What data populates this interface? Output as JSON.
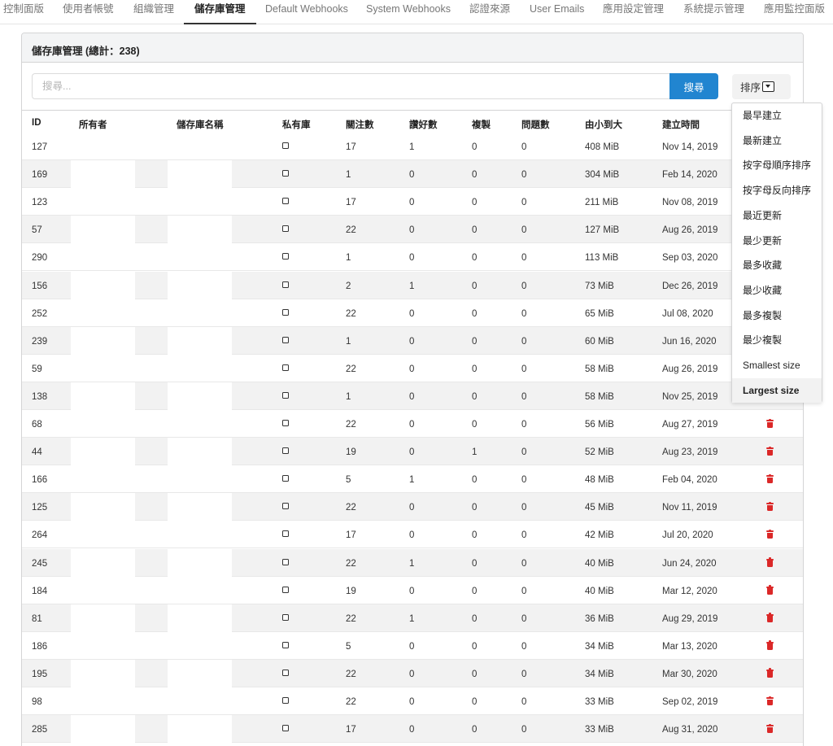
{
  "nav": {
    "tabs": [
      "控制面版",
      "使用者帳號",
      "組織管理",
      "儲存庫管理",
      "Default Webhooks",
      "System Webhooks",
      "認證來源",
      "User Emails",
      "應用設定管理",
      "系統提示管理",
      "應用監控面版"
    ],
    "active_tab": "儲存庫管理"
  },
  "panel": {
    "title": "儲存庫管理 (總計：238)"
  },
  "search": {
    "placeholder": "搜尋...",
    "button_label": "搜尋"
  },
  "sort": {
    "label": "排序",
    "options": [
      "最早建立",
      "最新建立",
      "按字母順序排序",
      "按字母反向排序",
      "最近更新",
      "最少更新",
      "最多收藏",
      "最少收藏",
      "最多複製",
      "最少複製",
      "Smallest size",
      "Largest size"
    ],
    "selected": "Largest size"
  },
  "table": {
    "columns": [
      "ID",
      "所有者",
      "儲存庫名稱",
      "私有庫",
      "關注數",
      "讚好數",
      "複製",
      "問題數",
      "由小到大",
      "建立時間"
    ],
    "rows": [
      [
        "127",
        "17",
        "1",
        "0",
        "0",
        "408 MiB",
        "Nov 14, 2019"
      ],
      [
        "169",
        "1",
        "0",
        "0",
        "0",
        "304 MiB",
        "Feb 14, 2020"
      ],
      [
        "123",
        "17",
        "0",
        "0",
        "0",
        "211 MiB",
        "Nov 08, 2019"
      ],
      [
        "57",
        "22",
        "0",
        "0",
        "0",
        "127 MiB",
        "Aug 26, 2019"
      ],
      [
        "290",
        "1",
        "0",
        "0",
        "0",
        "113 MiB",
        "Sep 03, 2020"
      ],
      [
        "156",
        "2",
        "1",
        "0",
        "0",
        "73 MiB",
        "Dec 26, 2019"
      ],
      [
        "252",
        "22",
        "0",
        "0",
        "0",
        "65 MiB",
        "Jul 08, 2020"
      ],
      [
        "239",
        "1",
        "0",
        "0",
        "0",
        "60 MiB",
        "Jun 16, 2020"
      ],
      [
        "59",
        "22",
        "0",
        "0",
        "0",
        "58 MiB",
        "Aug 26, 2019"
      ],
      [
        "138",
        "1",
        "0",
        "0",
        "0",
        "58 MiB",
        "Nov 25, 2019"
      ],
      [
        "68",
        "22",
        "0",
        "0",
        "0",
        "56 MiB",
        "Aug 27, 2019"
      ],
      [
        "44",
        "19",
        "0",
        "1",
        "0",
        "52 MiB",
        "Aug 23, 2019"
      ],
      [
        "166",
        "5",
        "1",
        "0",
        "0",
        "48 MiB",
        "Feb 04, 2020"
      ],
      [
        "125",
        "22",
        "0",
        "0",
        "0",
        "45 MiB",
        "Nov 11, 2019"
      ],
      [
        "264",
        "17",
        "0",
        "0",
        "0",
        "42 MiB",
        "Jul 20, 2020"
      ],
      [
        "245",
        "22",
        "1",
        "0",
        "0",
        "40 MiB",
        "Jun 24, 2020"
      ],
      [
        "184",
        "19",
        "0",
        "0",
        "0",
        "40 MiB",
        "Mar 12, 2020"
      ],
      [
        "81",
        "22",
        "1",
        "0",
        "0",
        "36 MiB",
        "Aug 29, 2019"
      ],
      [
        "186",
        "5",
        "0",
        "0",
        "0",
        "34 MiB",
        "Mar 13, 2020"
      ],
      [
        "195",
        "22",
        "0",
        "0",
        "0",
        "34 MiB",
        "Mar 30, 2020"
      ],
      [
        "98",
        "22",
        "0",
        "0",
        "0",
        "33 MiB",
        "Sep 02, 2019"
      ],
      [
        "285",
        "17",
        "0",
        "0",
        "0",
        "33 MiB",
        "Aug 31, 2020"
      ]
    ]
  },
  "colors": {
    "accent": "#2185d0",
    "danger": "#db2828",
    "row_alt": "#f2f2f2"
  }
}
